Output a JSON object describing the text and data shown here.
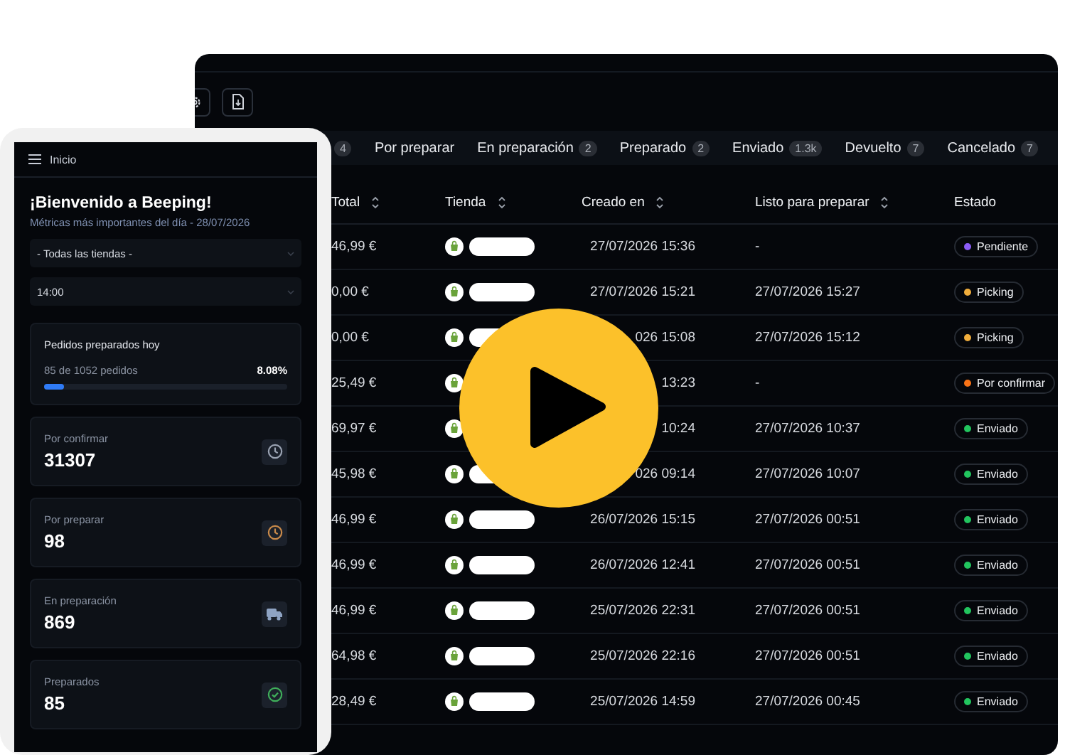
{
  "dashboard": {
    "menu_title": "Inicio",
    "title": "¡Bienvenido a Beeping!",
    "subtitle": "Métricas más importantes del día - 28/07/2026",
    "store_select": {
      "value": "- Todas las tiendas -"
    },
    "time_select": {
      "value": "14:00"
    },
    "progress": {
      "title": "Pedidos preparados hoy",
      "detail": "85 de 1052 pedidos",
      "percent": "8.08%",
      "level": 0.0808
    },
    "stats": [
      {
        "label": "Por confirmar",
        "value": "31307",
        "kind": "clock",
        "color": "#9aa3b2"
      },
      {
        "label": "Por preparar",
        "value": "98",
        "kind": "clock",
        "color": "#c98a4a"
      },
      {
        "label": "En preparación",
        "value": "869",
        "kind": "truck",
        "color": "#8fa4c4"
      },
      {
        "label": "Preparados",
        "value": "85",
        "kind": "check",
        "color": "#3fae5a"
      }
    ]
  },
  "orders": {
    "tabs": [
      {
        "count": "4"
      },
      {
        "label": "Por preparar"
      },
      {
        "label": "En preparación",
        "count": "2"
      },
      {
        "label": "Preparado",
        "count": "2"
      },
      {
        "label": "Enviado",
        "count": "1.3k"
      },
      {
        "label": "Devuelto",
        "count": "7"
      },
      {
        "label": "Cancelado",
        "count": "7"
      }
    ],
    "columns": [
      {
        "label": "Total",
        "sortable": true
      },
      {
        "label": "Tienda",
        "sortable": true
      },
      {
        "label": "Creado en",
        "sortable": true
      },
      {
        "label": "Listo para preparar",
        "sortable": true
      },
      {
        "label": "Estado",
        "sortable": false
      }
    ],
    "rows": [
      {
        "total": "46,99 €",
        "created": "27/07/2026 15:36",
        "ready": "-",
        "status": {
          "label": "Pendiente",
          "color": "#8b5cf6"
        }
      },
      {
        "total": "0,00 €",
        "created": "27/07/2026 15:21",
        "ready": "27/07/2026 15:27",
        "status": {
          "label": "Picking",
          "color": "#f0ad3c"
        }
      },
      {
        "total": "0,00 €",
        "created": "026 15:08",
        "ready": "27/07/2026 15:12",
        "status": {
          "label": "Picking",
          "color": "#f0ad3c"
        }
      },
      {
        "total": "25,49 €",
        "created": "13:23",
        "ready": "-",
        "status": {
          "label": "Por confirmar",
          "color": "#f97316"
        }
      },
      {
        "total": "69,97 €",
        "created": "10:24",
        "ready": "27/07/2026 10:37",
        "status": {
          "label": "Enviado",
          "color": "#22c55e"
        }
      },
      {
        "total": "45,98 €",
        "created": "026 09:14",
        "ready": "27/07/2026 10:07",
        "status": {
          "label": "Enviado",
          "color": "#22c55e"
        }
      },
      {
        "total": "46,99 €",
        "created": "26/07/2026 15:15",
        "ready": "27/07/2026 00:51",
        "status": {
          "label": "Enviado",
          "color": "#22c55e"
        }
      },
      {
        "total": "46,99 €",
        "created": "26/07/2026 12:41",
        "ready": "27/07/2026 00:51",
        "status": {
          "label": "Enviado",
          "color": "#22c55e"
        }
      },
      {
        "total": "46,99 €",
        "created": "25/07/2026 22:31",
        "ready": "27/07/2026 00:51",
        "status": {
          "label": "Enviado",
          "color": "#22c55e"
        }
      },
      {
        "total": "64,98 €",
        "created": "25/07/2026 22:16",
        "ready": "27/07/2026 00:51",
        "status": {
          "label": "Enviado",
          "color": "#22c55e"
        }
      },
      {
        "total": "28,49 €",
        "created": "25/07/2026 14:59",
        "ready": "27/07/2026 00:45",
        "status": {
          "label": "Enviado",
          "color": "#22c55e"
        }
      }
    ]
  }
}
